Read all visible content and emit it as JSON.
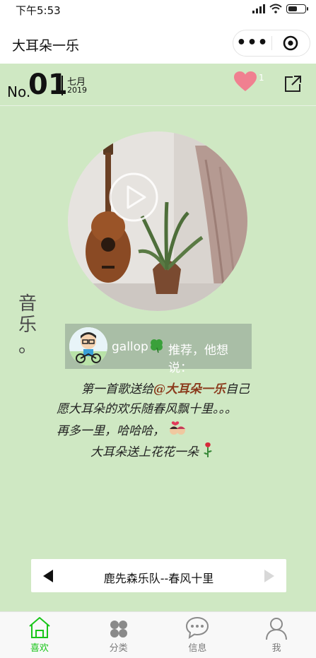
{
  "status_bar": {
    "time": "下午5:53",
    "battery_level": 0.55
  },
  "nav": {
    "title": "大耳朵一乐",
    "more_icon": "more-dots-icon",
    "close_icon": "target-close-icon"
  },
  "issue": {
    "no_label": "No.",
    "number": "01",
    "month": "七月",
    "year": "2019",
    "likes": "1"
  },
  "side_text": [
    "音",
    "乐",
    "。"
  ],
  "recommend": {
    "user": "gallop",
    "text": "推荐，他想说："
  },
  "message": {
    "line1_prefix": "第一首歌送给",
    "line1_mention": "@大耳朵一乐",
    "line1_suffix": "自己",
    "line2": "愿大耳朵的欢乐随春风飘十里。。。",
    "line3": "再多一里，哈哈哈，",
    "line4": "大耳朵送上花花一朵"
  },
  "player": {
    "track": "鹿先森乐队--春风十里"
  },
  "tabs": [
    {
      "label": "喜欢",
      "icon": "home-icon",
      "active": true
    },
    {
      "label": "分类",
      "icon": "category-icon",
      "active": false
    },
    {
      "label": "信息",
      "icon": "chat-icon",
      "active": false
    },
    {
      "label": "我",
      "icon": "person-icon",
      "active": false
    }
  ],
  "colors": {
    "background": "#cfe8c3",
    "accent": "#19c519",
    "heart": "#f08090",
    "mention": "#8b3a1c"
  }
}
